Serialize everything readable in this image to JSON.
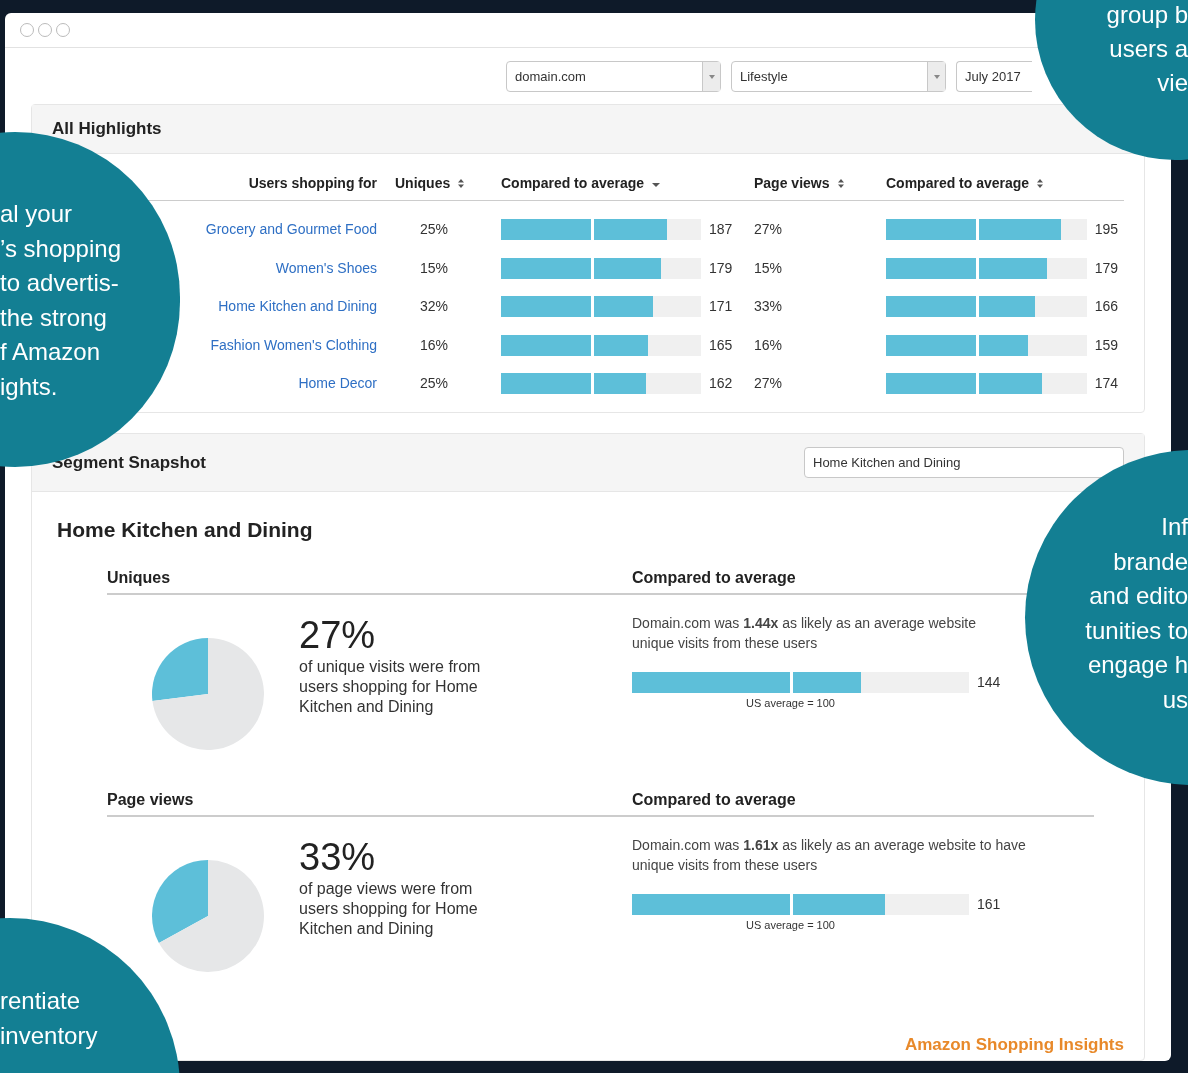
{
  "filters": [
    {
      "value": "domain.com"
    },
    {
      "value": "Lifestyle"
    },
    {
      "value": "July 2017"
    }
  ],
  "highlights": {
    "title": "All Highlights",
    "columns": [
      {
        "label": "Users shopping for",
        "kind": "plain"
      },
      {
        "label": "Uniques",
        "kind": "sortable"
      },
      {
        "label": "Compared to average",
        "kind": "sorted"
      },
      {
        "label": "Page views",
        "kind": "sortable"
      },
      {
        "label": "Compared to average",
        "kind": "sortable"
      }
    ],
    "rows": [
      {
        "category": "Grocery and Gourmet Food",
        "uniques": "25%",
        "uniques_bar": {
          "level": 0.83,
          "value": "187"
        },
        "page_views": "27%",
        "page_views_bar": {
          "level": 0.87,
          "value": "195"
        }
      },
      {
        "category": "Women's Shoes",
        "uniques": "15%",
        "uniques_bar": {
          "level": 0.8,
          "value": "179"
        },
        "page_views": "15%",
        "page_views_bar": {
          "level": 0.8,
          "value": "179"
        }
      },
      {
        "category": "Home Kitchen and Dining",
        "uniques": "32%",
        "uniques_bar": {
          "level": 0.76,
          "value": "171"
        },
        "page_views": "33%",
        "page_views_bar": {
          "level": 0.745,
          "value": "166"
        }
      },
      {
        "category": "Fashion Women's Clothing",
        "uniques": "16%",
        "uniques_bar": {
          "level": 0.735,
          "value": "165"
        },
        "page_views": "16%",
        "page_views_bar": {
          "level": 0.71,
          "value": "159"
        }
      },
      {
        "category": "Home Decor",
        "uniques": "25%",
        "uniques_bar": {
          "level": 0.725,
          "value": "162"
        },
        "page_views": "27%",
        "page_views_bar": {
          "level": 0.78,
          "value": "174"
        }
      }
    ]
  },
  "snapshot": {
    "title": "Segment Snapshot",
    "segment_select": "Home Kitchen and Dining",
    "heading": "Home Kitchen and Dining",
    "sections": [
      {
        "label": "Uniques",
        "compare_label": "Compared to average",
        "pie": {
          "chart_data": {
            "type": "pie",
            "values": [
              27,
              73
            ]
          }
        },
        "percent": "27%",
        "description": "of unique visits were from users shopping for Home Kitchen and Dining",
        "comparison": [
          "Domain.com was **1.44x** as likely as an average website",
          "unique visits from these users"
        ],
        "bar": {
          "level": 0.68,
          "value": "144"
        },
        "caption": "US average = 100"
      },
      {
        "label": "Page views",
        "compare_label": "Compared to average",
        "pie": {
          "chart_data": {
            "type": "pie",
            "values": [
              33,
              67
            ]
          }
        },
        "percent": "33%",
        "description": "of page views were from users shopping for Home Kitchen and Dining",
        "comparison": [
          "Domain.com was **1.61x** as likely as an average website to have",
          "unique visits from these users"
        ],
        "bar": {
          "level": 0.75,
          "value": "161"
        },
        "caption": "US average = 100"
      }
    ],
    "brand": "Amazon Shopping Insights"
  },
  "callouts": [
    {
      "kind": "top-right",
      "lines": [
        "group b",
        "users a",
        "vie"
      ]
    },
    {
      "kind": "left",
      "lines": [
        "al your",
        "’s shopping",
        "to advertis-",
        "the strong",
        "f Amazon",
        "ights."
      ]
    },
    {
      "kind": "right",
      "lines": [
        "Inf",
        "brande",
        "and edito",
        "tunities to",
        "engage h",
        "us"
      ]
    },
    {
      "kind": "bottom-left",
      "lines": [
        "rentiate",
        "inventory"
      ]
    }
  ]
}
